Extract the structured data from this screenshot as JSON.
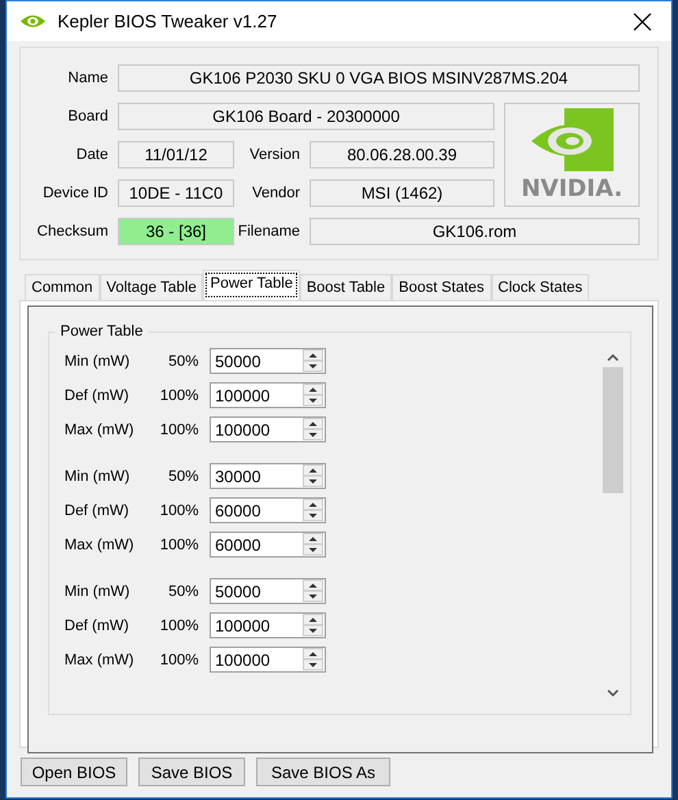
{
  "window": {
    "title": "Kepler BIOS Tweaker v1.27"
  },
  "info": {
    "name": {
      "label": "Name",
      "value": "GK106 P2030 SKU 0 VGA BIOS MSINV287MS.204"
    },
    "board": {
      "label": "Board",
      "value": "GK106 Board - 20300000"
    },
    "date": {
      "label": "Date",
      "value": "11/01/12"
    },
    "version": {
      "label": "Version",
      "value": "80.06.28.00.39"
    },
    "device_id": {
      "label": "Device ID",
      "value": "10DE - 11C0"
    },
    "vendor": {
      "label": "Vendor",
      "value": "MSI (1462)"
    },
    "checksum": {
      "label": "Checksum",
      "value": "36 - [36]",
      "ok": true
    },
    "filename": {
      "label": "Filename",
      "value": "GK106.rom"
    },
    "logo": {
      "text": "NVIDIA."
    }
  },
  "tabs": [
    {
      "label": "Common",
      "selected": false
    },
    {
      "label": "Voltage Table",
      "selected": false
    },
    {
      "label": "Power Table",
      "selected": true
    },
    {
      "label": "Boost Table",
      "selected": false
    },
    {
      "label": "Boost States",
      "selected": false
    },
    {
      "label": "Clock States",
      "selected": false
    }
  ],
  "power_table": {
    "title": "Power Table",
    "groups": [
      [
        {
          "label": "Min (mW)",
          "percent": "50%",
          "value": "50000"
        },
        {
          "label": "Def (mW)",
          "percent": "100%",
          "value": "100000"
        },
        {
          "label": "Max (mW)",
          "percent": "100%",
          "value": "100000"
        }
      ],
      [
        {
          "label": "Min (mW)",
          "percent": "50%",
          "value": "30000"
        },
        {
          "label": "Def (mW)",
          "percent": "100%",
          "value": "60000"
        },
        {
          "label": "Max (mW)",
          "percent": "100%",
          "value": "60000"
        }
      ],
      [
        {
          "label": "Min (mW)",
          "percent": "50%",
          "value": "50000"
        },
        {
          "label": "Def (mW)",
          "percent": "100%",
          "value": "100000"
        },
        {
          "label": "Max (mW)",
          "percent": "100%",
          "value": "100000"
        }
      ]
    ]
  },
  "buttons": [
    "Open BIOS",
    "Save BIOS",
    "Save BIOS As"
  ]
}
